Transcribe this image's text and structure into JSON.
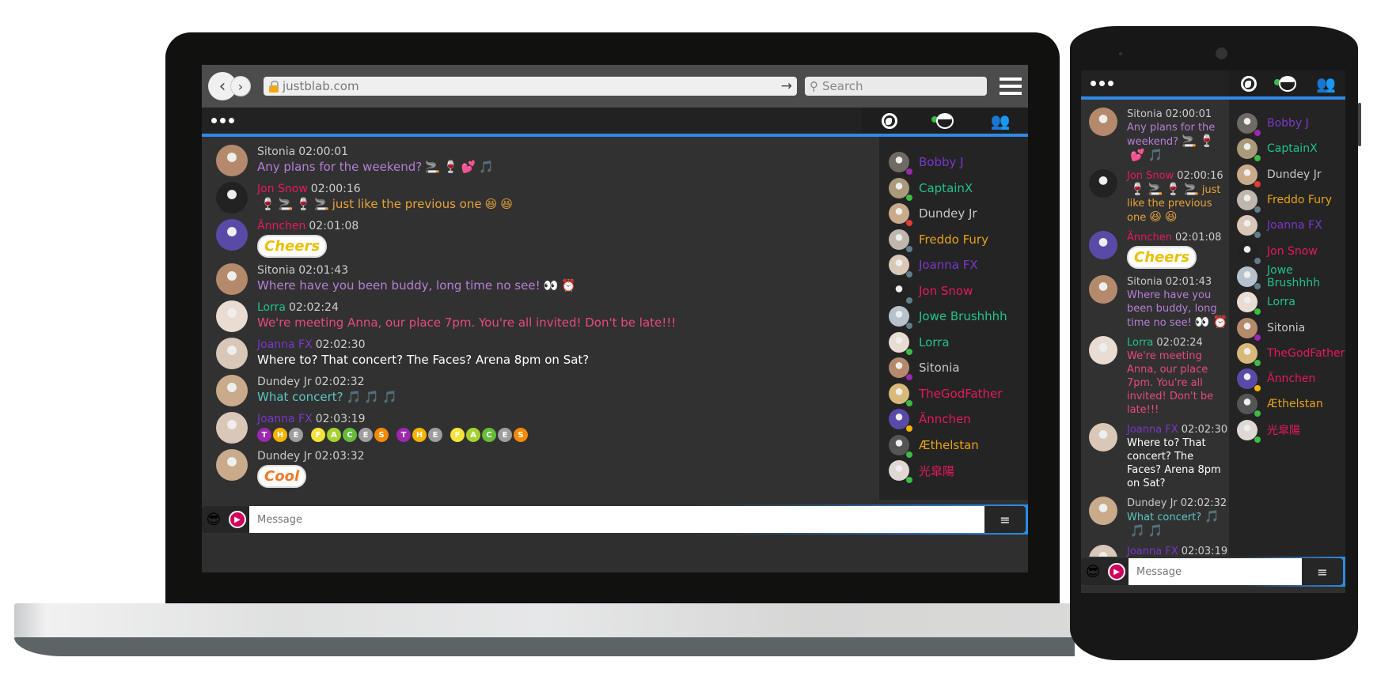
{
  "browser": {
    "url": "justblab.com",
    "search_placeholder": "Search",
    "back_icon": "chevron-left-icon",
    "forward_icon": "chevron-right-icon"
  },
  "header": {
    "menu_icon": "more-dots-icon",
    "tabs": [
      {
        "icon": "globe-icon",
        "label": "Public"
      },
      {
        "icon": "user-face-icon",
        "label": "Me"
      },
      {
        "icon": "people-icon",
        "label": "Users"
      }
    ]
  },
  "colors": {
    "accent": "#2f8be6",
    "background": "#313131",
    "sidebar": "#242424",
    "online": "#3dbb47"
  },
  "messages": [
    {
      "user": "Sitonia",
      "name_color": "#c8c8c8",
      "time": "02:00:01",
      "text": "Any plans for the weekend?",
      "text_color": "#b67fd6",
      "emojis": [
        "🚬",
        "🍷",
        "💕",
        "🎵"
      ],
      "avatar_color": "#b58a6c"
    },
    {
      "user": "Jon Snow",
      "name_color": "#e8195a",
      "time": "02:00:16",
      "pre_emojis": [
        "🍷",
        "🚬",
        "🍷",
        "🚬"
      ],
      "text": "just like the previous one",
      "text_color": "#e8a23a",
      "emojis": [
        "😆",
        "😆"
      ],
      "avatar_color": "#222222"
    },
    {
      "user": "Ännchen",
      "name_color": "#e8195a",
      "time": "02:01:08",
      "sticker": "Cheers",
      "avatar_color": "#5a4aa8"
    },
    {
      "user": "Sitonia",
      "name_color": "#c8c8c8",
      "time": "02:01:43",
      "text": "Where have you been buddy, long time no see!",
      "text_color": "#b67fd6",
      "emojis": [
        "👀",
        "⏰"
      ],
      "avatar_color": "#b58a6c"
    },
    {
      "user": "Lorra",
      "name_color": "#1fc38e",
      "time": "02:02:24",
      "text": "We're meeting Anna, our place 7pm. You're all invited! Don't be late!!!",
      "text_color": "#e84a7a",
      "avatar_color": "#e8dcd3"
    },
    {
      "user": "Joanna FX",
      "name_color": "#7a37c9",
      "time": "02:02:30",
      "text": "Where to? That concert? The Faces? Arena 8pm on Sat?",
      "text_color": "#ffffff",
      "avatar_color": "#d9c7b8"
    },
    {
      "user": "Dundey Jr",
      "name_color": "#c8c8c8",
      "time": "02:02:32",
      "text": "What concert?",
      "text_color": "#5cc7c0",
      "emojis": [
        "🎵",
        "🎵",
        "🎵"
      ],
      "avatar_color": "#c9ab8b"
    },
    {
      "user": "Joanna FX",
      "name_color": "#7a37c9",
      "time": "02:03:19",
      "letters": [
        "T",
        "H",
        "E",
        " ",
        "F",
        "A",
        "C",
        "E",
        "S",
        " ",
        "T",
        "H",
        "E",
        " ",
        "F",
        "A",
        "C",
        "E",
        "S"
      ],
      "avatar_color": "#d9c7b8"
    },
    {
      "user": "Dundey Jr",
      "name_color": "#c8c8c8",
      "time": "02:03:32",
      "sticker": "Cool",
      "avatar_color": "#c9ab8b"
    }
  ],
  "letter_colors": {
    "T": "#9c27b0",
    "H": "#f5b400",
    "E": "#9e9e9e",
    "F": "#f5e33a",
    "A": "#a6d132",
    "C": "#66bb3a",
    "S": "#f58a00"
  },
  "users": [
    {
      "name": "Bobby J",
      "color": "#7a37c9",
      "status": "#9c27b0",
      "avatar_color": "#6f6a63"
    },
    {
      "name": "CaptainX",
      "color": "#1fc38e",
      "status": "#3dbb47",
      "avatar_color": "#a89a7a"
    },
    {
      "name": "Dundey Jr",
      "color": "#c8c8c8",
      "status": "#e53935",
      "avatar_color": "#c9ab8b"
    },
    {
      "name": "Freddo Fury",
      "color": "#e8a21a",
      "status": "#607d8b",
      "avatar_color": "#bfb6ae"
    },
    {
      "name": "Joanna FX",
      "color": "#7a37c9",
      "status": "#607d8b",
      "avatar_color": "#d9c7b8"
    },
    {
      "name": "Jon Snow",
      "color": "#e8195a",
      "status": "#607d8b",
      "avatar_color": "#222222"
    },
    {
      "name": "Jowe Brushhhh",
      "color": "#1fc38e",
      "status": "#607d8b",
      "avatar_color": "#b7c2cc"
    },
    {
      "name": "Lorra",
      "color": "#1fc38e",
      "status": "#3dbb47",
      "avatar_color": "#e8dcd3"
    },
    {
      "name": "Sitonia",
      "color": "#c8c8c8",
      "status": "#9c27b0",
      "avatar_color": "#b58a6c"
    },
    {
      "name": "TheGodFather",
      "color": "#e8195a",
      "status": "#3dbb47",
      "avatar_color": "#d9b97a"
    },
    {
      "name": "Ännchen",
      "color": "#e8195a",
      "status": "#f5b400",
      "avatar_color": "#5a4aa8"
    },
    {
      "name": "Æthelstan",
      "color": "#e8a21a",
      "status": "#3dbb47",
      "avatar_color": "#555555"
    },
    {
      "name": "光皐陽",
      "color": "#e8195a",
      "status": "#3dbb47",
      "avatar_color": "#e0d8d2"
    }
  ],
  "composer": {
    "placeholder": "Message",
    "emoji_icon": "😎",
    "send_icon": "≡"
  }
}
